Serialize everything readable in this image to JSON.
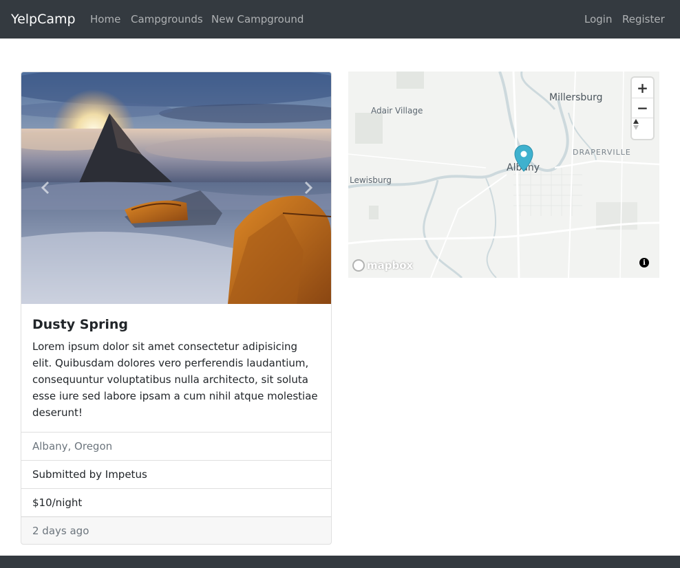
{
  "navbar": {
    "brand": "YelpCamp",
    "links": [
      "Home",
      "Campgrounds",
      "New Campground"
    ],
    "auth_links": [
      "Login",
      "Register"
    ]
  },
  "campground": {
    "title": "Dusty Spring",
    "description": "Lorem ipsum dolor sit amet consectetur adipisicing elit. Quibusdam dolores vero perferendis laudantium, consequuntur voluptatibus nulla architecto, sit soluta esse iure sed labore ipsam a cum nihil atque molestiae deserunt!",
    "location": "Albany, Oregon",
    "submitted_by": "Submitted by Impetus",
    "price": "$10/night",
    "posted": "2 days ago"
  },
  "carousel": {
    "prev_icon": "chevron-left-icon",
    "next_icon": "chevron-right-icon"
  },
  "map": {
    "labels": {
      "millersburg": "Millersburg",
      "adair_village": "Adair Village",
      "draperville": "DRAPERVILLE",
      "lewisburg": "Lewisburg",
      "albany": "Albany"
    },
    "zoom_in": "+",
    "zoom_out": "−",
    "compass_icon": "compass-icon",
    "logo_text": "mapbox",
    "attribution": "i",
    "marker_color": "#3fb1ce"
  },
  "colors": {
    "navbar": "#343a40",
    "map_water": "#cfd8dc",
    "map_land": "#f2f3f1"
  }
}
